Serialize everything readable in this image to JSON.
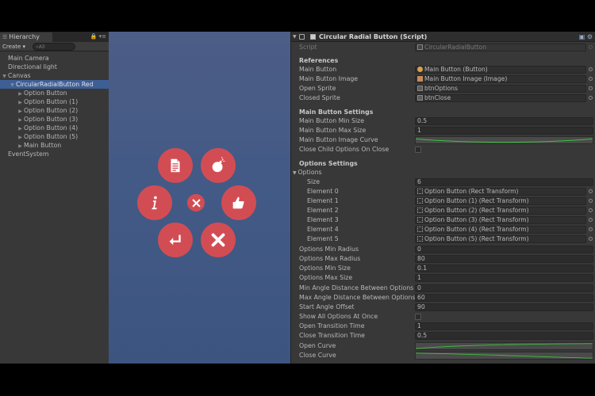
{
  "hierarchy": {
    "tab_label": "Hierarchy",
    "create_label": "Create",
    "search_placeholder": "All",
    "items": [
      {
        "label": "Main Camera"
      },
      {
        "label": "Directional light"
      },
      {
        "label": "Canvas"
      },
      {
        "label": "CircularRadialButton Red"
      },
      {
        "label": "Option Button"
      },
      {
        "label": "Option Button (1)"
      },
      {
        "label": "Option Button (2)"
      },
      {
        "label": "Option Button (3)"
      },
      {
        "label": "Option Button (4)"
      },
      {
        "label": "Option Button (5)"
      },
      {
        "label": "Main Button"
      },
      {
        "label": "EventSystem"
      }
    ]
  },
  "scene": {
    "button_color": "#d24d53",
    "background_top": "#4c5d86",
    "background_bottom": "#3c5580",
    "buttons": [
      {
        "icon": "document-icon"
      },
      {
        "icon": "bomb-icon"
      },
      {
        "icon": "info-icon"
      },
      {
        "icon": "close-icon"
      },
      {
        "icon": "thumbs-up-icon"
      },
      {
        "icon": "return-icon"
      },
      {
        "icon": "close-icon"
      }
    ]
  },
  "inspector": {
    "title": "Circular Radial Button (Script)",
    "script_label": "Script",
    "script_value": "CircularRadialButton",
    "references_header": "References",
    "main_button_label": "Main Button",
    "main_button_value": "Main Button (Button)",
    "main_button_image_label": "Main Button Image",
    "main_button_image_value": "Main Button Image (Image)",
    "open_sprite_label": "Open Sprite",
    "open_sprite_value": "btnOptions",
    "closed_sprite_label": "Closed Sprite",
    "closed_sprite_value": "btnClose",
    "main_settings_header": "Main Button Settings",
    "min_size_label": "Main Button Min Size",
    "min_size_value": "0.5",
    "max_size_label": "Main Button Max Size",
    "max_size_value": "1",
    "image_curve_label": "Main Button Image Curve",
    "close_child_label": "Close Child Options On Close",
    "options_settings_header": "Options Settings",
    "options_label": "Options",
    "size_label": "Size",
    "size_value": "6",
    "elements": [
      {
        "label": "Element 0",
        "value": "Option Button (Rect Transform)"
      },
      {
        "label": "Element 1",
        "value": "Option Button (1) (Rect Transform)"
      },
      {
        "label": "Element 2",
        "value": "Option Button (2) (Rect Transform)"
      },
      {
        "label": "Element 3",
        "value": "Option Button (3) (Rect Transform)"
      },
      {
        "label": "Element 4",
        "value": "Option Button (4) (Rect Transform)"
      },
      {
        "label": "Element 5",
        "value": "Option Button (5) (Rect Transform)"
      }
    ],
    "min_radius_label": "Options Min Radius",
    "min_radius_value": "0",
    "max_radius_label": "Options Max Radius",
    "max_radius_value": "80",
    "opt_min_size_label": "Options Min Size",
    "opt_min_size_value": "0.1",
    "opt_max_size_label": "Options Max Size",
    "opt_max_size_value": "1",
    "min_angle_label": "Min Angle Distance Between Options",
    "min_angle_value": "0",
    "max_angle_label": "Max Angle Distance Between Options",
    "max_angle_value": "60",
    "start_angle_label": "Start Angle Offset",
    "start_angle_value": "90",
    "show_all_label": "Show All Options At Once",
    "open_time_label": "Open Transition Time",
    "open_time_value": "1",
    "close_time_label": "Close Transition Time",
    "close_time_value": "0.5",
    "open_curve_label": "Open Curve",
    "close_curve_label": "Close Curve",
    "curve_color": "#3fbf3f"
  }
}
